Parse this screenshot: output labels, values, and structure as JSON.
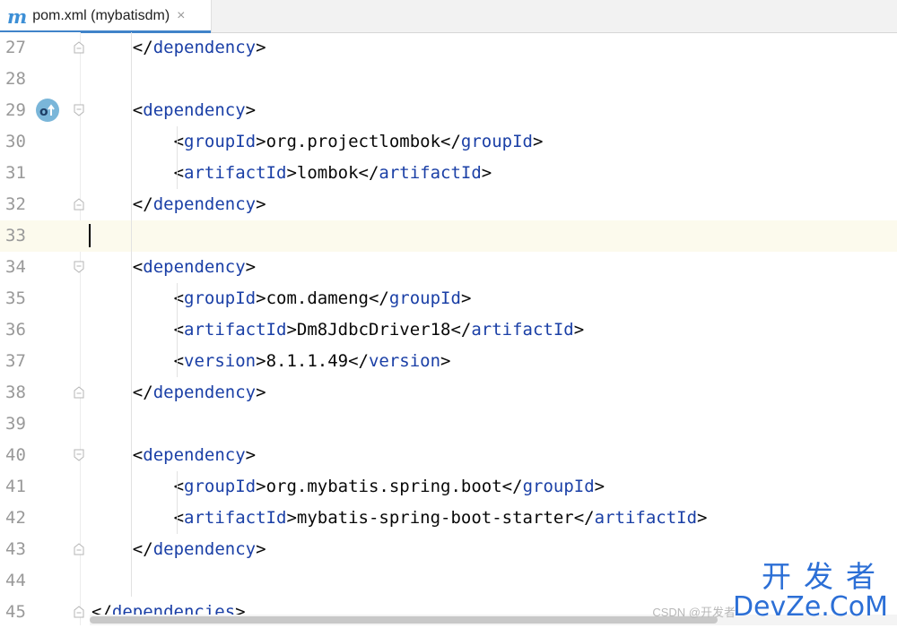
{
  "tab": {
    "icon": "m",
    "title": "pom.xml (mybatisdm)",
    "close": "×"
  },
  "lines": [
    {
      "num": "27",
      "indent": 2,
      "pre": "</",
      "tag": "dependency",
      "mid": "",
      "text": "",
      "ctag": "",
      "post": ">"
    },
    {
      "num": "28",
      "indent": 0,
      "pre": "",
      "tag": "",
      "mid": "",
      "text": "",
      "ctag": "",
      "post": ""
    },
    {
      "num": "29",
      "indent": 2,
      "pre": "<",
      "tag": "dependency",
      "mid": "",
      "text": "",
      "ctag": "",
      "post": ">"
    },
    {
      "num": "30",
      "indent": 3,
      "pre": "<",
      "tag": "groupId",
      "mid": ">",
      "text": "org.projectlombok</",
      "ctag": "groupId",
      "post": ">"
    },
    {
      "num": "31",
      "indent": 3,
      "pre": "<",
      "tag": "artifactId",
      "mid": ">",
      "text": "lombok</",
      "ctag": "artifactId",
      "post": ">"
    },
    {
      "num": "32",
      "indent": 2,
      "pre": "</",
      "tag": "dependency",
      "mid": "",
      "text": "",
      "ctag": "",
      "post": ">"
    },
    {
      "num": "33",
      "indent": 0,
      "pre": "",
      "tag": "",
      "mid": "",
      "text": "",
      "ctag": "",
      "post": ""
    },
    {
      "num": "34",
      "indent": 2,
      "pre": "<",
      "tag": "dependency",
      "mid": "",
      "text": "",
      "ctag": "",
      "post": ">"
    },
    {
      "num": "35",
      "indent": 3,
      "pre": "<",
      "tag": "groupId",
      "mid": ">",
      "text": "com.dameng</",
      "ctag": "groupId",
      "post": ">"
    },
    {
      "num": "36",
      "indent": 3,
      "pre": "<",
      "tag": "artifactId",
      "mid": ">",
      "text": "Dm8JdbcDriver18</",
      "ctag": "artifactId",
      "post": ">"
    },
    {
      "num": "37",
      "indent": 3,
      "pre": "<",
      "tag": "version",
      "mid": ">",
      "text": "8.1.1.49</",
      "ctag": "version",
      "post": ">"
    },
    {
      "num": "38",
      "indent": 2,
      "pre": "</",
      "tag": "dependency",
      "mid": "",
      "text": "",
      "ctag": "",
      "post": ">"
    },
    {
      "num": "39",
      "indent": 0,
      "pre": "",
      "tag": "",
      "mid": "",
      "text": "",
      "ctag": "",
      "post": ""
    },
    {
      "num": "40",
      "indent": 2,
      "pre": "<",
      "tag": "dependency",
      "mid": "",
      "text": "",
      "ctag": "",
      "post": ">"
    },
    {
      "num": "41",
      "indent": 3,
      "pre": "<",
      "tag": "groupId",
      "mid": ">",
      "text": "org.mybatis.spring.boot</",
      "ctag": "groupId",
      "post": ">"
    },
    {
      "num": "42",
      "indent": 3,
      "pre": "<",
      "tag": "artifactId",
      "mid": ">",
      "text": "mybatis-spring-boot-starter</",
      "ctag": "artifactId",
      "post": ">"
    },
    {
      "num": "43",
      "indent": 2,
      "pre": "</",
      "tag": "dependency",
      "mid": "",
      "text": "",
      "ctag": "",
      "post": ">"
    },
    {
      "num": "44",
      "indent": 0,
      "pre": "",
      "tag": "",
      "mid": "",
      "text": "",
      "ctag": "",
      "post": ""
    },
    {
      "num": "45",
      "indent": 1,
      "pre": "</",
      "tag": "dependencies",
      "mid": "",
      "text": "",
      "ctag": "",
      "post": ">"
    }
  ],
  "current_line": "33",
  "gutter_marker": {
    "line": "29",
    "icon": "override-up-icon",
    "glyph": "o↑"
  },
  "watermark": {
    "cn": "开发者",
    "en": "DevZe.CoM",
    "csdn": "CSDN @开发者"
  },
  "colors": {
    "tag": "#1a3fa6",
    "text": "#080808",
    "current_line_bg": "#fcfaed",
    "line_number": "#999999"
  }
}
